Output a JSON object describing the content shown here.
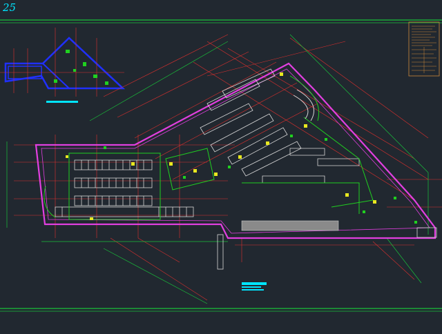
{
  "sheet": {
    "number": "25"
  },
  "colors": {
    "background": "#212830",
    "frame": "#19c23a",
    "outline": "#e23fe0",
    "grid_line": "#e0302e",
    "parking": "#d8d8d8",
    "detail_green": "#20d020",
    "detail_yellow": "#e8e820",
    "blue_wall": "#2030ff",
    "cyan_text": "#00e5ff",
    "notes": "#d08a3a"
  },
  "icons": [
    "drawing-sheet-icon",
    "key-plan-icon",
    "notes-table-icon",
    "floor-plan-icon",
    "title-bar-icon"
  ]
}
